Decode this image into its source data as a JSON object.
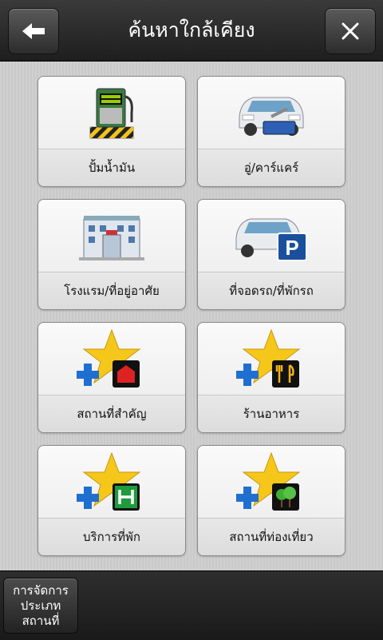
{
  "header": {
    "title": "ค้นหาใกล้เคียง",
    "back_icon": "back-arrow-icon",
    "close_icon": "close-icon"
  },
  "categories": [
    {
      "label": "ปั้มน้ำมัน",
      "icon": "fuel-pump-icon"
    },
    {
      "label": "อู่/คาร์แคร์",
      "icon": "car-repair-icon"
    },
    {
      "label": "โรงแรม/ที่อยู่อาศัย",
      "icon": "hotel-icon"
    },
    {
      "label": "ที่จอดรถ/ที่พักรถ",
      "icon": "parking-icon"
    },
    {
      "label": "สถานที่สำคัญ",
      "icon": "landmark-add-icon"
    },
    {
      "label": "ร้านอาหาร",
      "icon": "restaurant-add-icon"
    },
    {
      "label": "บริการที่พัก",
      "icon": "lodging-add-icon"
    },
    {
      "label": "สถานที่ท่องเที่ยว",
      "icon": "tourism-add-icon"
    }
  ],
  "footer": {
    "manage_line1": "การจัดการ",
    "manage_line2": "ประเภท",
    "manage_line3": "สถานที่"
  }
}
